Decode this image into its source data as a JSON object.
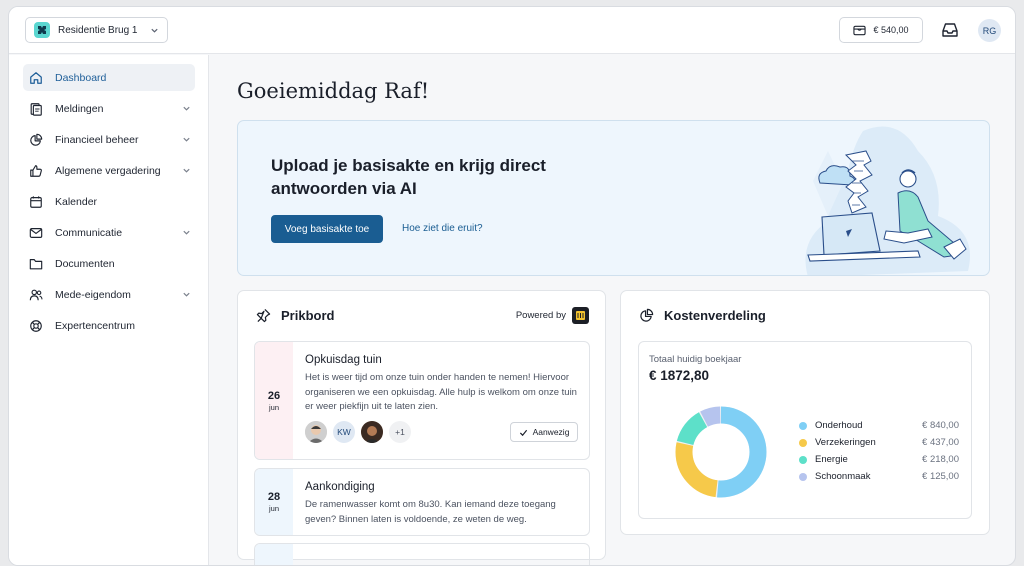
{
  "topbar": {
    "project_name": "Residentie Brug 1",
    "balance": "€ 540,00",
    "user_initials": "RG"
  },
  "sidebar": {
    "items": [
      {
        "label": "Dashboard",
        "icon": "home-icon",
        "active": true,
        "has_chevron": false
      },
      {
        "label": "Meldingen",
        "icon": "notifications-icon",
        "active": false,
        "has_chevron": true
      },
      {
        "label": "Financieel beheer",
        "icon": "pie-chart-icon",
        "active": false,
        "has_chevron": true
      },
      {
        "label": "Algemene vergadering",
        "icon": "thumbs-up-icon",
        "active": false,
        "has_chevron": true
      },
      {
        "label": "Kalender",
        "icon": "calendar-icon",
        "active": false,
        "has_chevron": false
      },
      {
        "label": "Communicatie",
        "icon": "mail-icon",
        "active": false,
        "has_chevron": true
      },
      {
        "label": "Documenten",
        "icon": "folder-icon",
        "active": false,
        "has_chevron": false
      },
      {
        "label": "Mede-eigendom",
        "icon": "users-icon",
        "active": false,
        "has_chevron": true
      },
      {
        "label": "Expertencentrum",
        "icon": "lifebuoy-icon",
        "active": false,
        "has_chevron": false
      }
    ]
  },
  "main": {
    "greeting": "Goeiemiddag Raf!",
    "hero": {
      "title": "Upload je basisakte en krijg direct antwoorden via AI",
      "primary_button": "Voeg basisakte toe",
      "secondary_link": "Hoe ziet die eruit?"
    },
    "prikbord": {
      "title": "Prikbord",
      "powered_by": "Powered by",
      "posts": [
        {
          "day": "26",
          "month": "jun",
          "title": "Opkuisdag tuin",
          "body": "Het is weer tijd om onze tuin onder handen te nemen! Hiervoor organiseren we een opkuisdag. Alle hulp is welkom om onze tuin er weer piekfijn uit te laten zien.",
          "attendee_initials": "KW",
          "attendee_more": "+1",
          "present_label": "Aanwezig"
        },
        {
          "day": "28",
          "month": "jun",
          "title": "Aankondiging",
          "body": "De ramenwasser komt om 8u30. Kan iemand deze toegang geven? Binnen laten is voldoende, ze weten de weg."
        }
      ]
    },
    "kosten": {
      "title": "Kostenverdeling",
      "label": "Totaal huidig boekjaar",
      "total": "€ 1872,80",
      "items": [
        {
          "name": "Onderhoud",
          "value": "€ 840,00",
          "amount": 840,
          "color": "#7fcff5"
        },
        {
          "name": "Verzekeringen",
          "value": "€ 437,00",
          "amount": 437,
          "color": "#f6c94a"
        },
        {
          "name": "Energie",
          "value": "€ 218,00",
          "amount": 218,
          "color": "#5de0c9"
        },
        {
          "name": "Schoonmaak",
          "value": "€ 125,00",
          "amount": 125,
          "color": "#b6c4ee"
        }
      ]
    }
  }
}
